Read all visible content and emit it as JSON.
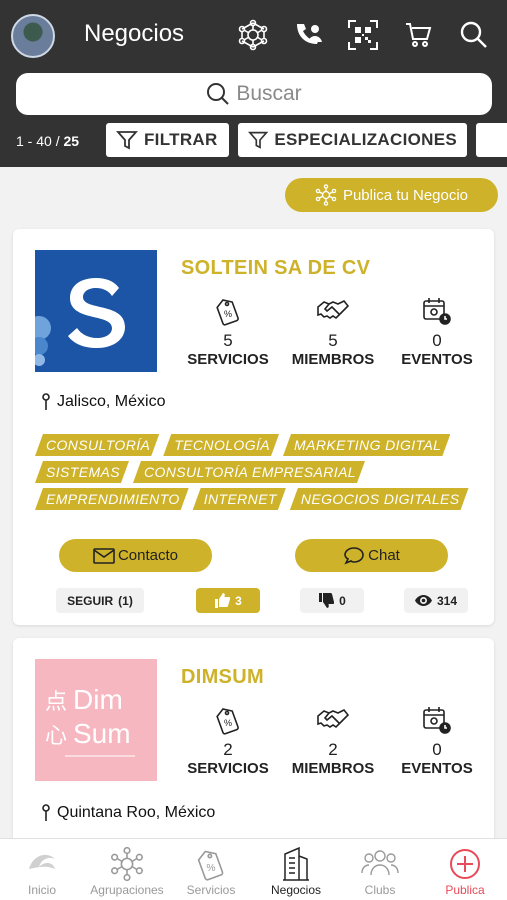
{
  "header": {
    "title": "Negocios"
  },
  "search": {
    "placeholder": "Buscar"
  },
  "filters": {
    "count_range": "1 - 40 / ",
    "count_total": "25",
    "filter_label": "FILTRAR",
    "specializations_label": "ESPECIALIZACIONES"
  },
  "publish_label": "Publica tu Negocio",
  "businesses": [
    {
      "name": "SOLTEIN SA DE CV",
      "stats": [
        {
          "value": "5",
          "label": "SERVICIOS"
        },
        {
          "value": "5",
          "label": "MIEMBROS"
        },
        {
          "value": "0",
          "label": "EVENTOS"
        }
      ],
      "location": "Jalisco, México",
      "tags": [
        [
          "CONSULTORÍA",
          "TECNOLOGÍA",
          "MARKETING DIGITAL"
        ],
        [
          "SISTEMAS",
          "CONSULTORÍA EMPRESARIAL"
        ],
        [
          "EMPRENDIMIENTO",
          "INTERNET",
          "NEGOCIOS DIGITALES"
        ]
      ],
      "contact_label": "Contacto",
      "chat_label": "Chat",
      "follow_label": "SEGUIR",
      "follow_count": "(1)",
      "likes": "3",
      "dislikes": "0",
      "views": "314"
    },
    {
      "name": "DIMSUM",
      "logo_text_1": "Dim",
      "logo_text_2": "Sum",
      "stats": [
        {
          "value": "2",
          "label": "SERVICIOS"
        },
        {
          "value": "2",
          "label": "MIEMBROS"
        },
        {
          "value": "0",
          "label": "EVENTOS"
        }
      ],
      "location": "Quintana Roo, México"
    }
  ],
  "nav": [
    {
      "label": "Inicio",
      "icon": "home-icon"
    },
    {
      "label": "Agrupaciones",
      "icon": "network-icon"
    },
    {
      "label": "Servicios",
      "icon": "tag-icon"
    },
    {
      "label": "Negocios",
      "icon": "building-icon"
    },
    {
      "label": "Clubs",
      "icon": "group-icon"
    },
    {
      "label": "Publica",
      "icon": "plus-circle-icon"
    }
  ],
  "colors": {
    "header_bg": "#333333",
    "accent": "#cdb22a",
    "publish_red": "#e84a5a"
  }
}
